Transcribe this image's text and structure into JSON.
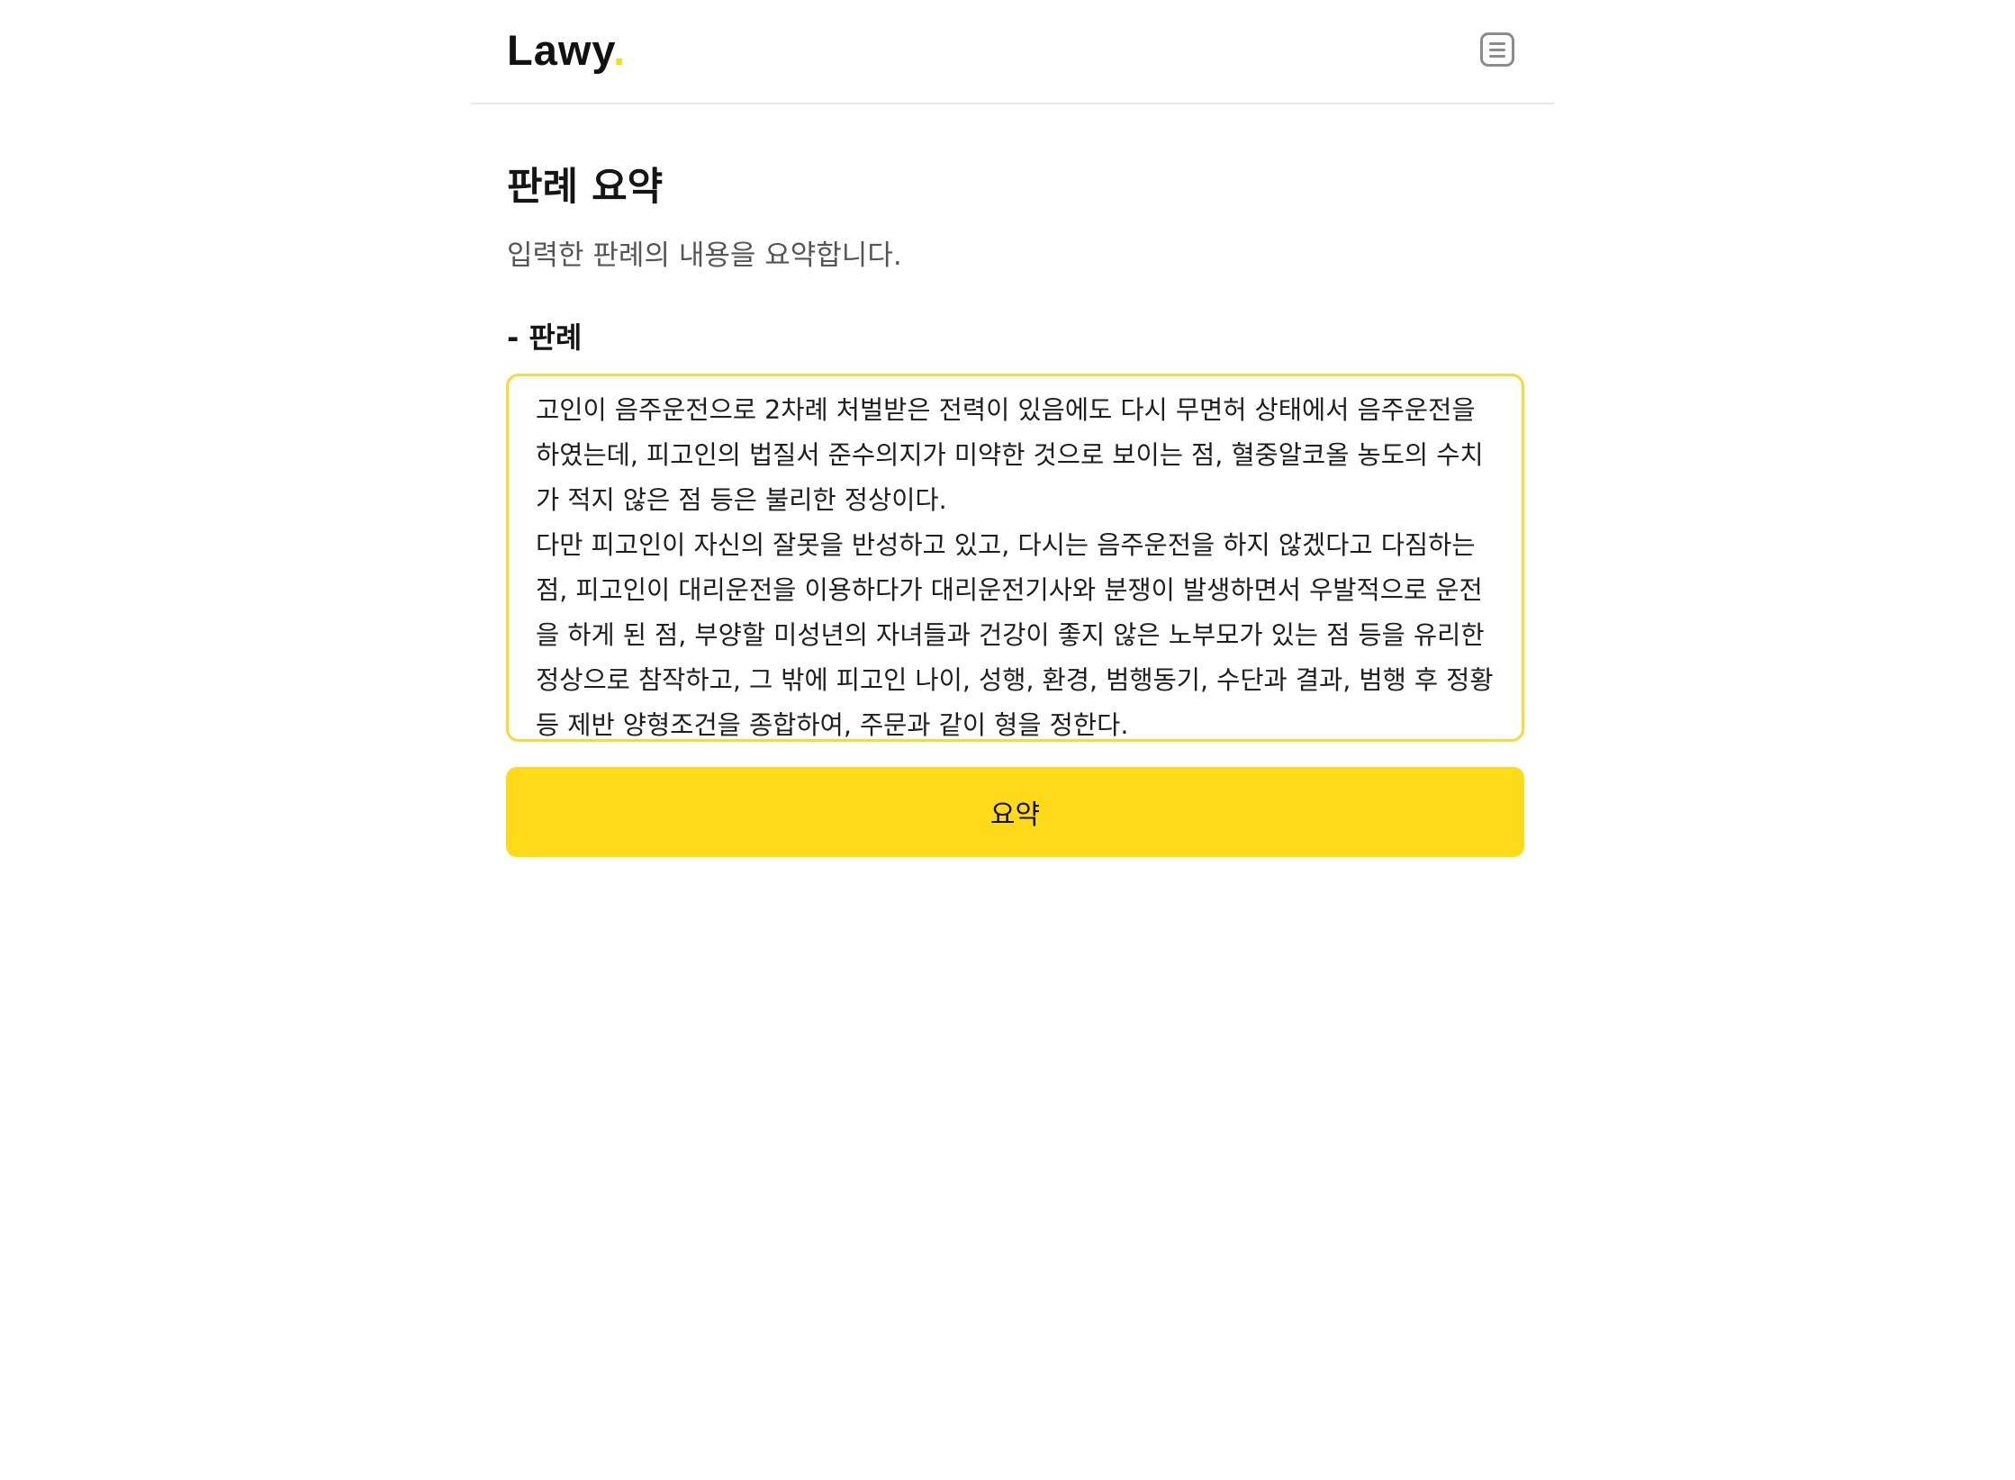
{
  "app": {
    "logo_text": "Lawy",
    "logo_dot": ".",
    "accent_color": "#ffda18"
  },
  "header": {
    "menu_icon": "hamburger-menu-icon"
  },
  "main": {
    "title": "판례 요약",
    "description": "입력한 판례의 내용을 요약합니다.",
    "field_label": "- 판례",
    "case_text": "고인이 음주운전으로 2차례 처벌받은 전력이 있음에도 다시 무면허 상태에서 음주운전을 하였는데, 피고인의 법질서 준수의지가 미약한 것으로 보이는 점, 혈중알코올 농도의 수치가 적지 않은 점 등은 불리한 정상이다.\n다만 피고인이 자신의 잘못을 반성하고 있고, 다시는 음주운전을 하지 않겠다고 다짐하는 점, 피고인이 대리운전을 이용하다가 대리운전기사와 분쟁이 발생하면서 우발적으로 운전을 하게 된 점, 부양할 미성년의 자녀들과 건강이 좋지 않은 노부모가 있는 점 등을 유리한 정상으로 참작하고, 그 밖에 피고인 나이, 성행, 환경, 범행동기, 수단과 결과, 범행 후 정황 등 제반 양형조건을 종합하여, 주문과 같이 형을 정한다.",
    "submit_label": "요약"
  }
}
